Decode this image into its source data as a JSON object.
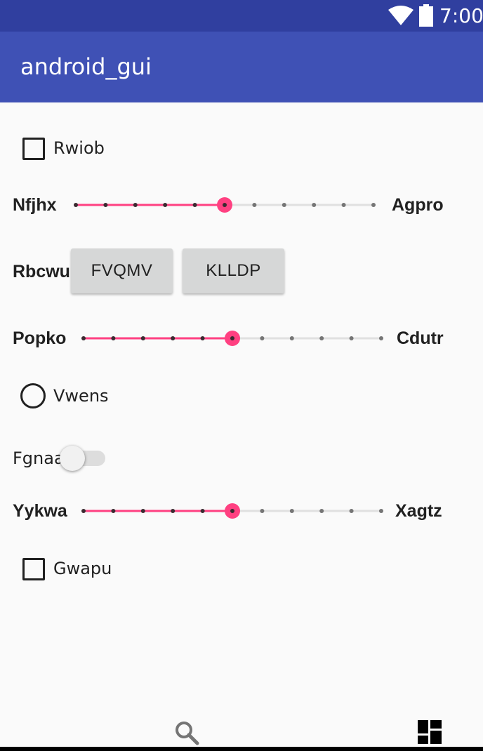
{
  "status_bar": {
    "time": "7:00"
  },
  "app_bar": {
    "title": "android_gui"
  },
  "form": {
    "checkbox1": {
      "label": "Rwiob",
      "checked": false
    },
    "slider1": {
      "left_label": "Nfjhx",
      "right_label": "Agpro",
      "value": 5,
      "max": 10
    },
    "button_row": {
      "label": "Rbcwu",
      "button1": "FVQMV",
      "button2": "KLLDP"
    },
    "slider2": {
      "left_label": "Popko",
      "right_label": "Cdutr",
      "value": 5,
      "max": 10
    },
    "radio1": {
      "label": "Vwens",
      "checked": false
    },
    "switch1": {
      "label": "Fgnaa",
      "on": false
    },
    "slider3": {
      "left_label": "Yykwa",
      "right_label": "Xagtz",
      "value": 5,
      "max": 10
    },
    "checkbox2": {
      "label": "Gwapu",
      "checked": false
    }
  },
  "bottom_nav": {
    "icons": [
      "search-icon",
      "dashboard-icon"
    ]
  },
  "colors": {
    "accent": "#ff4081",
    "primary": "#3f51b5",
    "primary_dark": "#303f9f"
  }
}
